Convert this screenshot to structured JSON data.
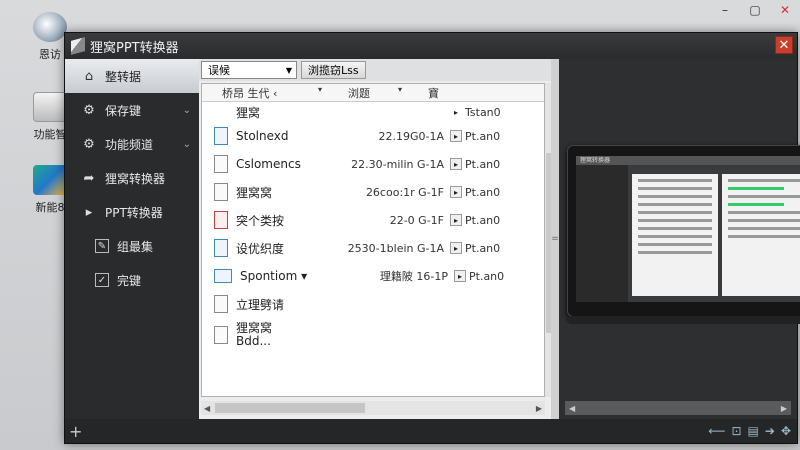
{
  "desktop": {
    "icons": [
      {
        "label": "恩访"
      },
      {
        "label": "功能智"
      },
      {
        "label": "新能8"
      }
    ],
    "controls": [
      "–",
      "▢",
      "✕"
    ]
  },
  "window": {
    "title": "狸窝PPT转换器",
    "close": "✕"
  },
  "sidebar": {
    "items": [
      {
        "label": "整转据",
        "icon": "home-icon"
      },
      {
        "label": "保存键",
        "icon": "gear-icon"
      },
      {
        "label": "功能频道",
        "icon": "gear-icon"
      },
      {
        "label": "狸窝转换器",
        "icon": "share-icon"
      },
      {
        "label": "PPT转换器",
        "icon": "play-icon"
      },
      {
        "label": "组最集",
        "icon": "edit-icon"
      },
      {
        "label": "完键",
        "icon": "checkbox-icon"
      }
    ]
  },
  "toolbar": {
    "combo_value": "误候",
    "button": "浏揽窃Lss"
  },
  "filelist": {
    "columns": [
      "桥昂 生代 ‹",
      "浏题",
      "寶"
    ],
    "rows": [
      {
        "name": "狸窝",
        "size": "",
        "stat": "Tstan0",
        "icon": "folder"
      },
      {
        "name": "Stolnexd",
        "size": "22.19G0-1A",
        "stat": "Pt.an0",
        "icon": "doc-blue"
      },
      {
        "name": "Cslomencs",
        "size": "22.30-milin G-1A",
        "stat": "Pt.an0",
        "icon": "doc"
      },
      {
        "name": "狸窝窝",
        "size": "26coo:1r G-1F",
        "stat": "Pt.an0",
        "icon": "doc"
      },
      {
        "name": "突个类按",
        "size": "22-0 G-1F",
        "stat": "Pt.an0",
        "icon": "doc-red"
      },
      {
        "name": "设优织度",
        "size": "2530-1blein G-1A",
        "stat": "Pt.an0",
        "icon": "doc-blue"
      },
      {
        "name": "Spontiom ▾",
        "size": "理籍陂 16-1P",
        "stat": "Pt.an0",
        "icon": "doc-blue"
      },
      {
        "name": "立理劈请",
        "size": "",
        "stat": "",
        "icon": "doc"
      },
      {
        "name": "狸窝窝",
        "name2": "Bdd...",
        "size": "",
        "stat": "",
        "icon": "doc"
      }
    ]
  },
  "preview": {
    "screen_title": "狸窝转换器"
  },
  "statusbar": {
    "add": "+",
    "tools": [
      "⟵",
      "⊡",
      "▤",
      "➔",
      "✥"
    ]
  }
}
